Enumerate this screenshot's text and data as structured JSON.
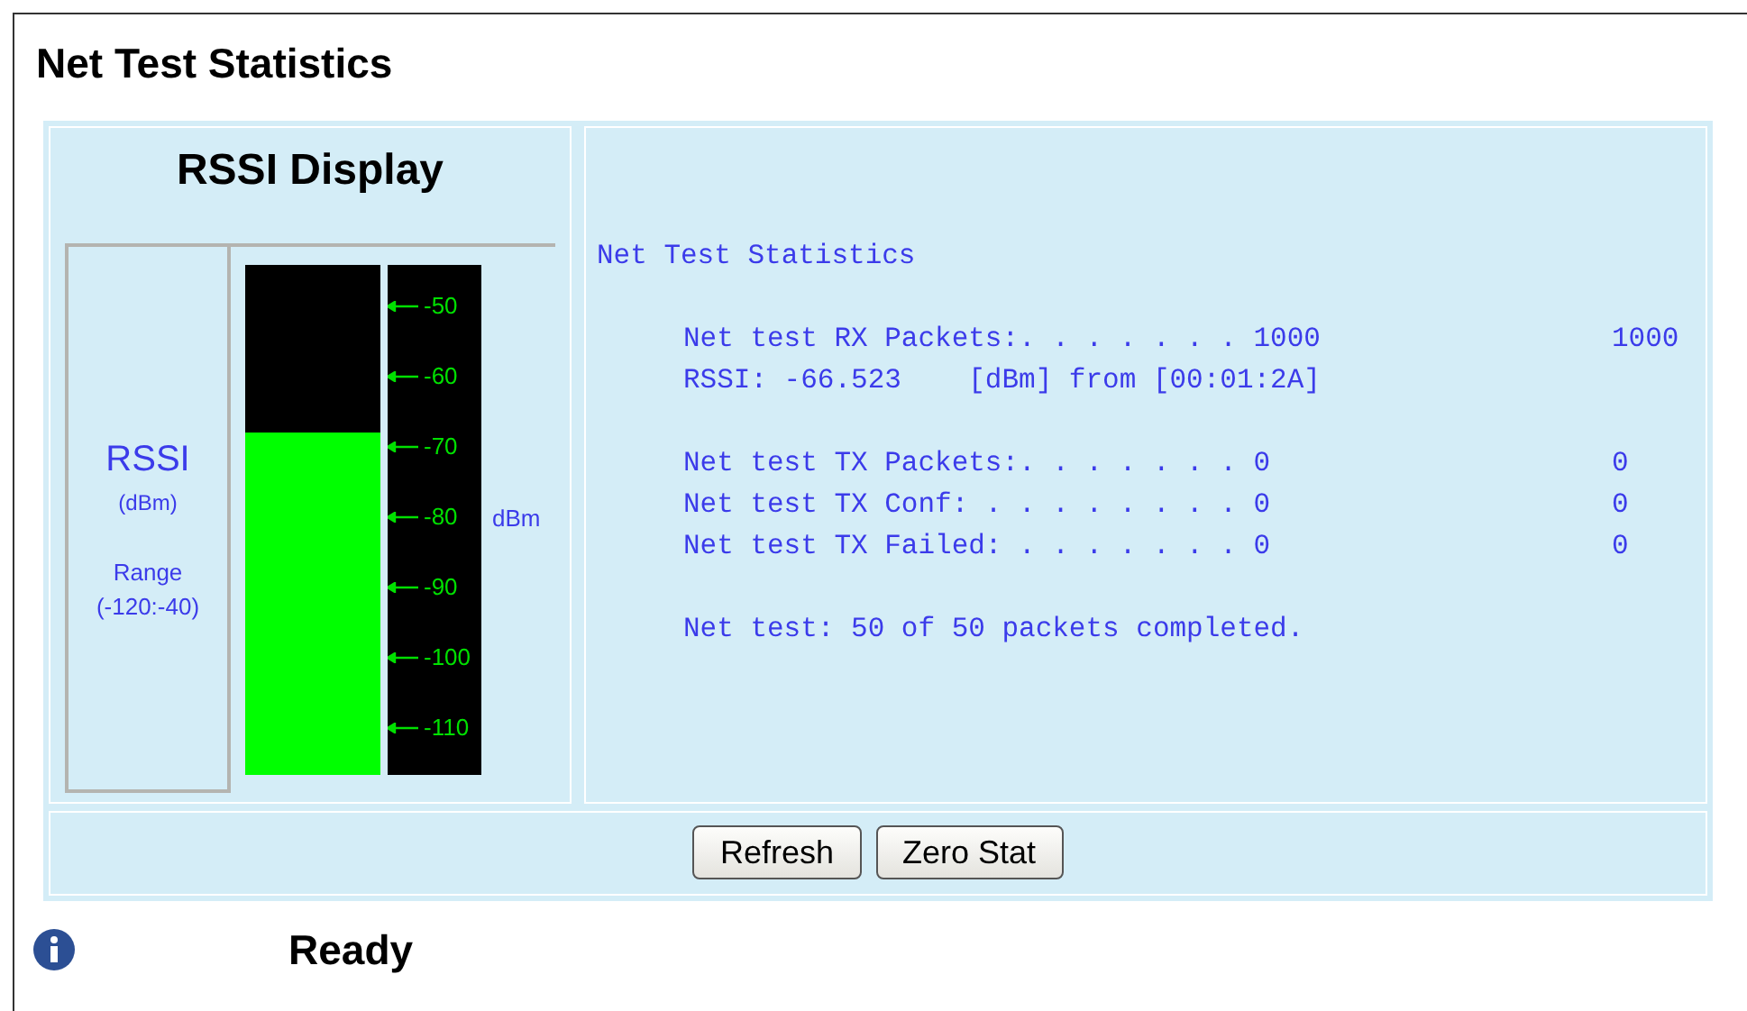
{
  "page_title": "Net Test Statistics",
  "rssi_panel": {
    "title": "RSSI Display",
    "label": "RSSI",
    "unit": "(dBm)",
    "range_label": "Range",
    "range": "(-120:-40)",
    "level": 0.67,
    "scale_unit": "dBm",
    "ticks": [
      "-50",
      "-60",
      "-70",
      "-80",
      "-90",
      "-100",
      "-110"
    ]
  },
  "stats": {
    "heading": "Net Test Statistics",
    "groups": [
      [
        {
          "label": "Net test RX Packets:. . . . . . . 1000",
          "value": "1000"
        },
        {
          "label": "RSSI: -66.523    [dBm] from [00:01:2A]"
        }
      ],
      [
        {
          "label": "Net test TX Packets:. . . . . . . 0",
          "value": "0"
        },
        {
          "label": "Net test TX Conf: . . . . . . . . 0",
          "value": "0"
        },
        {
          "label": "Net test TX Failed: . . . . . . . 0",
          "value": "0"
        }
      ],
      [
        {
          "label": "Net test: 50 of 50 packets completed."
        }
      ]
    ]
  },
  "buttons": [
    "Refresh",
    "Zero Stat"
  ],
  "status": "Ready"
}
